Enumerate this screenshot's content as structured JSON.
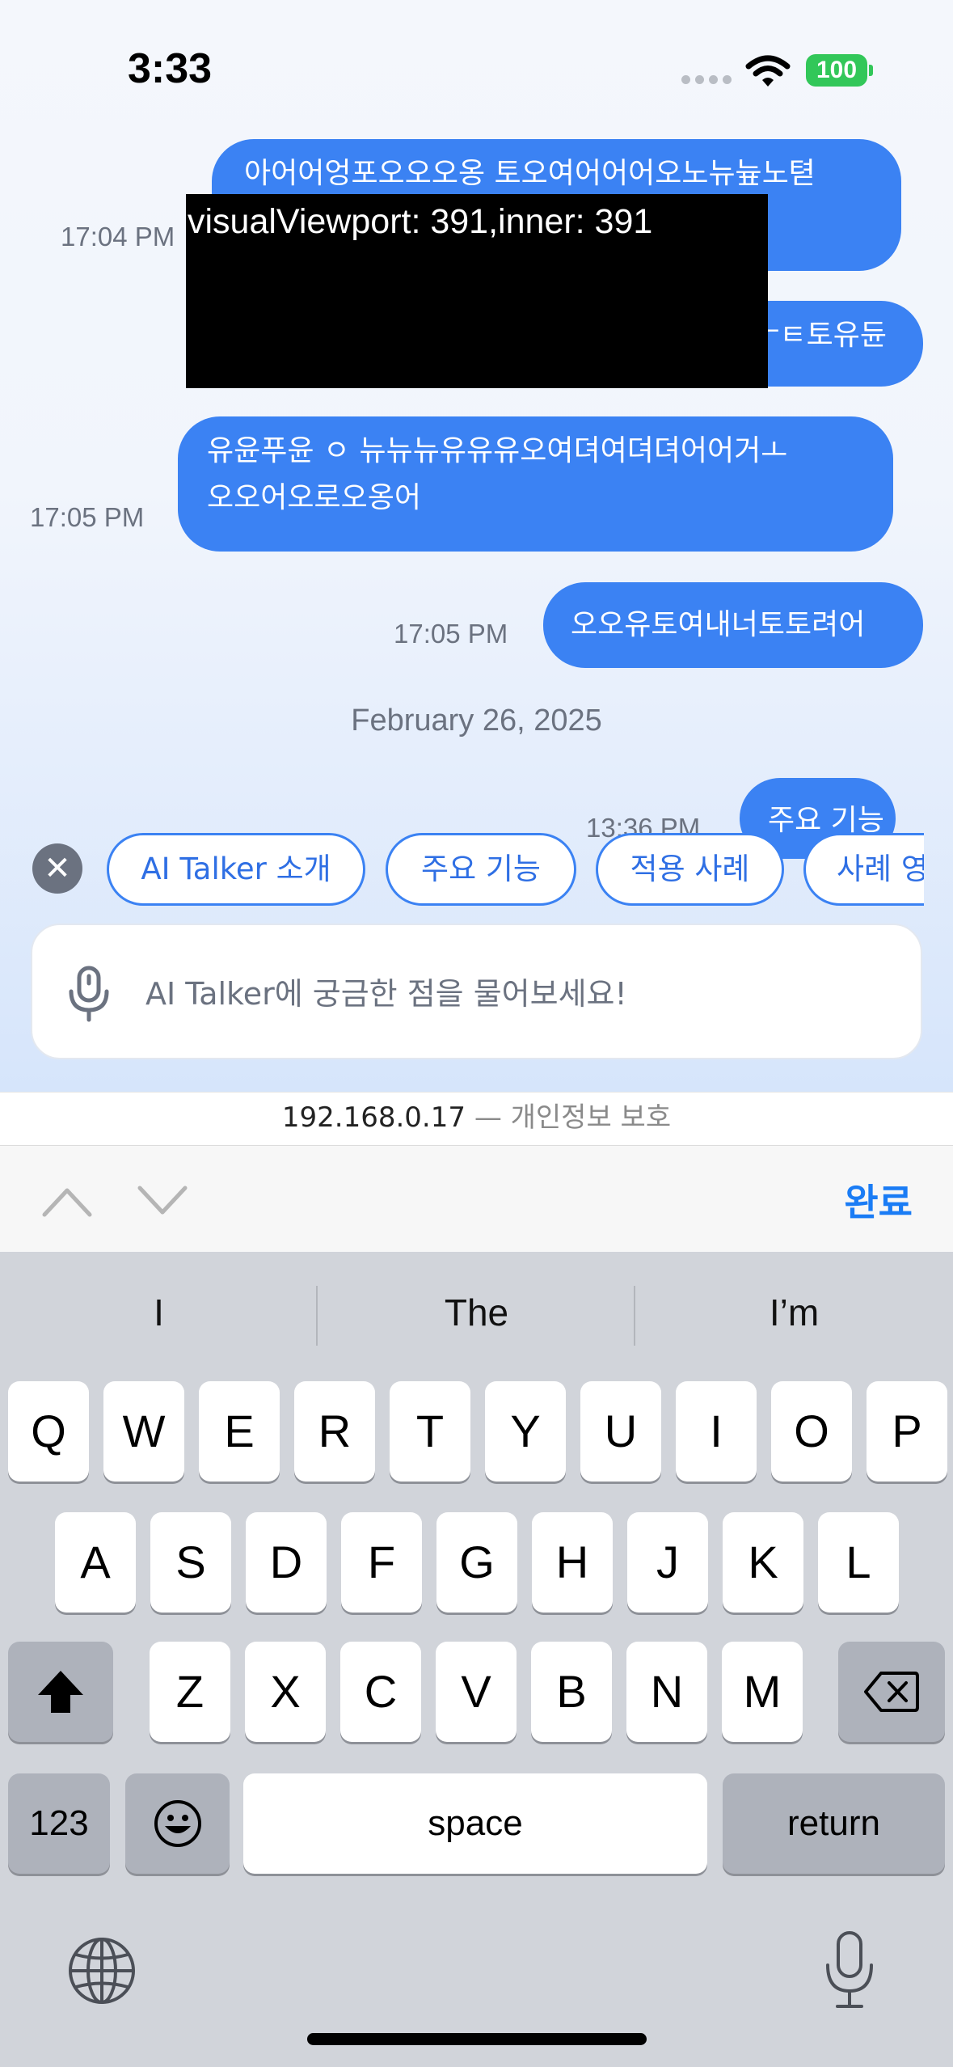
{
  "status_bar": {
    "time": "3:33",
    "battery_level": "100",
    "battery_color": "#32c759"
  },
  "chat": {
    "messages": [
      {
        "text": "아어어엉포오오오옹 토오여어어어오노뉴늎노텯",
        "time": "17:04 PM"
      },
      {
        "text": "ㅜㅌ토유듄",
        "time": ""
      },
      {
        "text_lines": [
          "유윤푸윤 ㅇ 뉴뉴뉴유유유오여뎌여뎌뎌어어거ㅗ",
          "오오어오로오옹어"
        ],
        "time": "17:05 PM"
      },
      {
        "text": "오오유토여내너토토려어",
        "time": "17:05 PM"
      },
      {
        "text": "주요 기능",
        "time": "13:36 PM"
      }
    ],
    "date_separator": "February 26, 2025",
    "bubble_color": "#3b82f3"
  },
  "debug_overlay": {
    "text": "visualViewport: 391,inner: 391"
  },
  "suggestions": {
    "close_icon": "close-icon",
    "chips": [
      "AI Talker 소개",
      "주요 기능",
      "적용 사례",
      "사례 영"
    ]
  },
  "input": {
    "placeholder": "AI Talker에 궁금한 점을 물어보세요!",
    "icon": "microphone-icon"
  },
  "browser": {
    "host": "192.168.0.17",
    "privacy_label": "— 개인정보 보호",
    "done_label": "완료",
    "accent_color": "#1a7cf5"
  },
  "keyboard": {
    "predictions": [
      "I",
      "The",
      "I’m"
    ],
    "row1": [
      "Q",
      "W",
      "E",
      "R",
      "T",
      "Y",
      "U",
      "I",
      "O",
      "P"
    ],
    "row2": [
      "A",
      "S",
      "D",
      "F",
      "G",
      "H",
      "J",
      "K",
      "L"
    ],
    "row3": [
      "Z",
      "X",
      "C",
      "V",
      "B",
      "N",
      "M"
    ],
    "numbers_label": "123",
    "space_label": "space",
    "return_label": "return"
  }
}
